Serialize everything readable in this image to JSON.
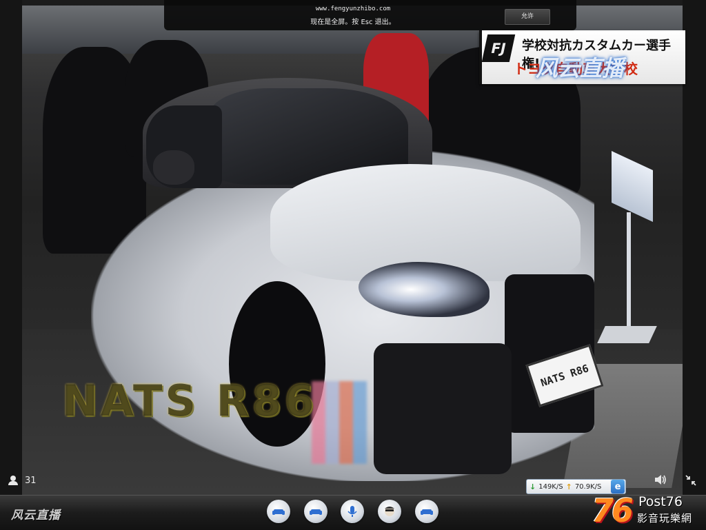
{
  "fullscreen_notice": {
    "url": "www.fengyunzhibo.com",
    "message": "现在是全屏。按 Esc 退出。",
    "allow_label": "允许"
  },
  "broadcast_logo": {
    "badge": "FJ",
    "line1": "学校対抗カスタムカー選手権!",
    "line2": "トヨタ自動車大学校",
    "overlay": "风云直播"
  },
  "video": {
    "license_plate": "NATS R86",
    "graffiti": "NATS R86"
  },
  "player": {
    "viewer_count": "31",
    "download_speed": "149K/S",
    "upload_speed": "70.9K/S",
    "brand": "风云直播",
    "controls": [
      "sofa-icon",
      "sofa-icon",
      "microphone-icon",
      "face-icon",
      "sofa-icon"
    ]
  },
  "watermark": {
    "number": "76",
    "name": "Post76",
    "subtitle": "影音玩樂網"
  },
  "colors": {
    "accent_orange": "#ff8a1f",
    "accent_red": "#d12a12",
    "bar_dark": "#1c1c1c"
  }
}
